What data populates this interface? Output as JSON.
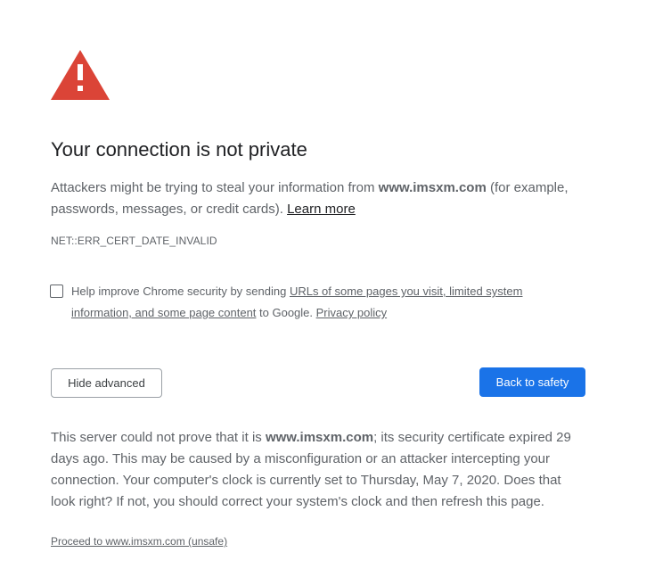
{
  "icon": "warning-triangle-icon",
  "colors": {
    "warning_red": "#db4437",
    "primary_blue": "#1a73e8",
    "text_secondary": "#5f6368",
    "text_primary": "#202124"
  },
  "title": "Your connection is not private",
  "intro": {
    "prefix": "Attackers might be trying to steal your information from ",
    "domain": "www.imsxm.com",
    "suffix": " (for example, passwords, messages, or credit cards). ",
    "learn_more": "Learn more"
  },
  "error_code": "NET::ERR_CERT_DATE_INVALID",
  "optin": {
    "checked": false,
    "prefix": "Help improve Chrome security by sending ",
    "link_text": "URLs of some pages you visit, limited system information, and some page content",
    "middle": " to Google. ",
    "privacy_link": "Privacy policy"
  },
  "buttons": {
    "hide_advanced": "Hide advanced",
    "back_to_safety": "Back to safety"
  },
  "details": {
    "prefix": "This server could not prove that it is ",
    "domain": "www.imsxm.com",
    "suffix": "; its security certificate expired 29 days ago. This may be caused by a misconfiguration or an attacker intercepting your connection. Your computer's clock is currently set to Thursday, May 7, 2020. Does that look right? If not, you should correct your system's clock and then refresh this page."
  },
  "proceed_link": "Proceed to www.imsxm.com (unsafe)"
}
